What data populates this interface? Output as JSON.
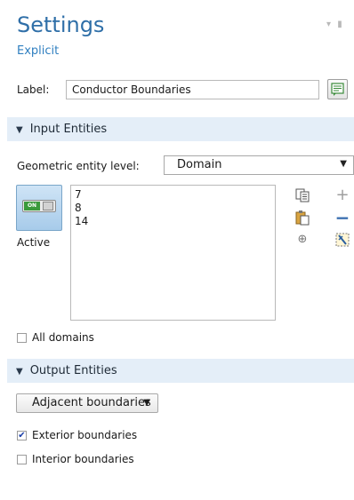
{
  "header": {
    "title": "Settings",
    "subtitle": "Explicit"
  },
  "label_field": {
    "label": "Label:",
    "value": "Conductor Boundaries"
  },
  "input_section": {
    "title": "Input Entities"
  },
  "geometric_level": {
    "label": "Geometric entity level:",
    "selected": "Domain"
  },
  "active_toggle": {
    "state_text": "ON",
    "label": "Active"
  },
  "selection_list": [
    "7",
    "8",
    "14"
  ],
  "all_domains": {
    "label": "All domains",
    "checked": false
  },
  "output_section": {
    "title": "Output Entities"
  },
  "output_type": {
    "selected": "Adjacent boundaries"
  },
  "exterior": {
    "label": "Exterior boundaries",
    "checked": true
  },
  "interior": {
    "label": "Interior boundaries",
    "checked": false
  },
  "colors": {
    "accent": "#2f6fa8",
    "section_bg": "#e4eef8",
    "plus_gray": "#9e9e9e",
    "minus_blue": "#3a6fb0"
  }
}
